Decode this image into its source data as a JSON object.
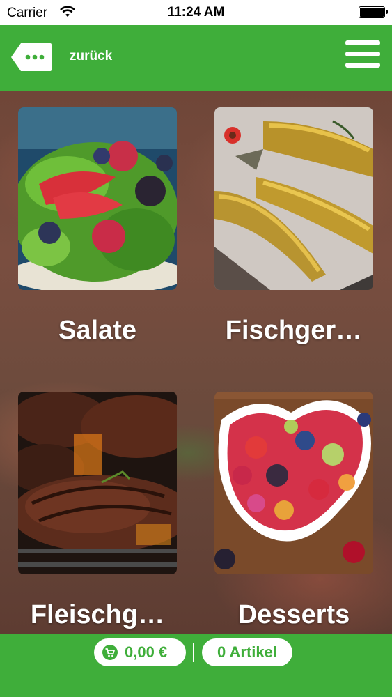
{
  "status_bar": {
    "carrier": "Carrier",
    "time": "11:24 AM"
  },
  "header": {
    "back_label": "zurück",
    "back_icon": "speech-bubble-dots-icon",
    "menu_icon": "hamburger-menu-icon"
  },
  "categories": [
    {
      "label": "Salate",
      "image": "salad-photo"
    },
    {
      "label": "Fischger…",
      "image": "smoked-fish-photo"
    },
    {
      "label": "Fleischg…",
      "image": "grilled-steak-photo"
    },
    {
      "label": "Desserts",
      "image": "fruit-bowl-photo"
    }
  ],
  "footer": {
    "cart_total": "0,00 €",
    "item_count": "0 Artikel",
    "cart_icon": "shopping-cart-icon"
  },
  "colors": {
    "accent_green": "#3fae3a",
    "white": "#ffffff"
  }
}
